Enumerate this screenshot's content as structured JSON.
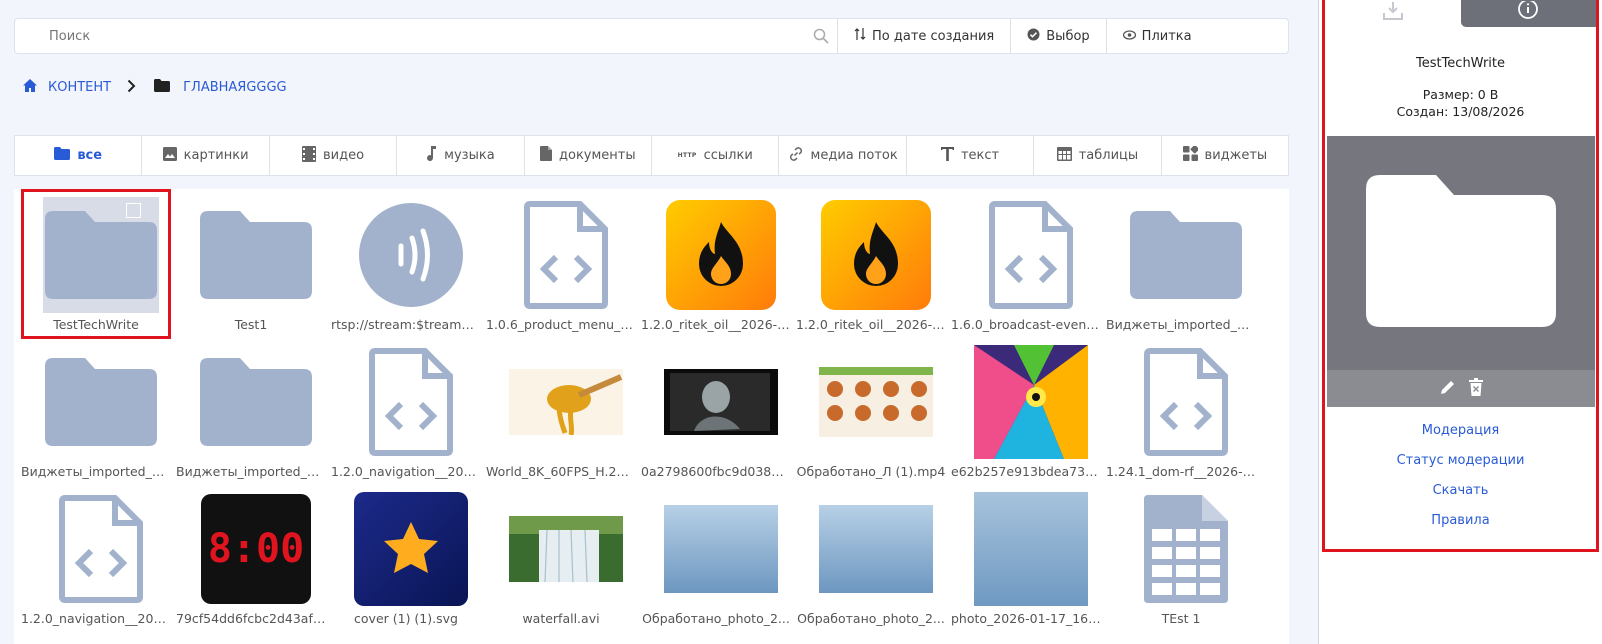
{
  "search": {
    "placeholder": "Поиск"
  },
  "toolbar": {
    "sort_label": "По дате создания",
    "select_label": "Выбор",
    "view_label": "Плитка"
  },
  "breadcrumb": {
    "root": "КОНТЕНТ",
    "current": "ГЛАВНАЯGGGG"
  },
  "filters": [
    {
      "label": "все",
      "icon": "folder-icon",
      "active": true
    },
    {
      "label": "картинки",
      "icon": "image-icon"
    },
    {
      "label": "видео",
      "icon": "film-icon"
    },
    {
      "label": "музыка",
      "icon": "music-note-icon"
    },
    {
      "label": "документы",
      "icon": "document-icon"
    },
    {
      "label": "ссылки",
      "icon": "http-icon",
      "icon_text": "HTTP"
    },
    {
      "label": "медиа поток",
      "icon": "link-icon"
    },
    {
      "label": "текст",
      "icon": "text-icon"
    },
    {
      "label": "таблицы",
      "icon": "table-icon"
    },
    {
      "label": "виджеты",
      "icon": "widgets-icon"
    }
  ],
  "items": [
    {
      "name": "TestTechWrite",
      "type": "folder",
      "selected": true
    },
    {
      "name": "Test1",
      "type": "folder"
    },
    {
      "name": "rtsp://stream:$tream1...",
      "type": "stream"
    },
    {
      "name": "1.0.6_product_menu_b...",
      "type": "code"
    },
    {
      "name": "1.2.0_ritek_oil__2026-0...",
      "type": "fire"
    },
    {
      "name": "1.2.0_ritek_oil__2026-0...",
      "type": "fire"
    },
    {
      "name": "1.6.0_broadcast-events...",
      "type": "code"
    },
    {
      "name": "Виджеты_imported_49...",
      "type": "folder"
    },
    {
      "name": "Виджеты_imported_d...",
      "type": "folder"
    },
    {
      "name": "Виджеты_imported_94...",
      "type": "folder"
    },
    {
      "name": "1.2.0_navigation__2026...",
      "type": "code"
    },
    {
      "name": "World_8K_60FPS_H.26...",
      "type": "honey"
    },
    {
      "name": "0a2798600fbc9d03827...",
      "type": "videoframe"
    },
    {
      "name": "Обработано_Л (1).mp4",
      "type": "burgers"
    },
    {
      "name": "e62b257e913bdea73f2...",
      "type": "lion"
    },
    {
      "name": "1.24.1_dom-rf__2026-0...",
      "type": "code"
    },
    {
      "name": "1.2.0_navigation__2026...",
      "type": "code"
    },
    {
      "name": "79cf54dd6fcbc2d43af5...",
      "type": "clock",
      "clock_text": "8:00"
    },
    {
      "name": "cover (1) (1).svg",
      "type": "star"
    },
    {
      "name": "waterfall.avi",
      "type": "waterfall"
    },
    {
      "name": "Обработано_photo_2...",
      "type": "sky"
    },
    {
      "name": "Обработано_photo_2...",
      "type": "sky"
    },
    {
      "name": "photo_2026-01-17_16-...",
      "type": "sky2"
    },
    {
      "name": "TEst 1",
      "type": "table"
    }
  ],
  "panel": {
    "title": "TestTechWrite",
    "size": "Размер: 0 B",
    "created": "Создан: 13/08/2026",
    "links": [
      "Модерация",
      "Статус модерации",
      "Скачать",
      "Правила"
    ]
  },
  "colors": {
    "accent": "#2a5bd7",
    "folder": "#a3b2cc",
    "highlight": "#e0141e"
  }
}
